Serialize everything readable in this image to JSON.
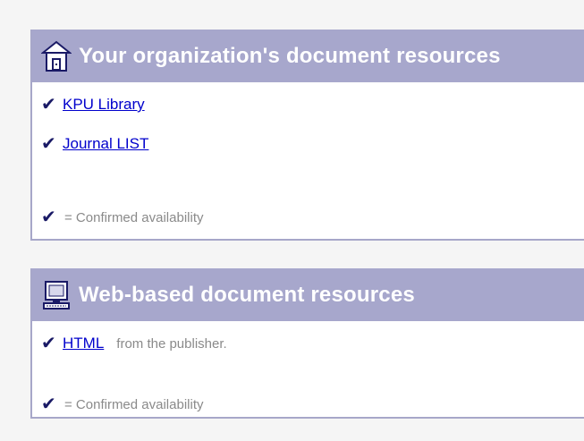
{
  "org_panel": {
    "title": "Your organization's document resources",
    "icon": "library-building-icon",
    "links": [
      {
        "check": "✔",
        "label": "KPU Library"
      },
      {
        "check": "✔",
        "label": "Journal LIST"
      }
    ],
    "legend": {
      "check": "✔",
      "text": "= Confirmed availability"
    }
  },
  "web_panel": {
    "title": "Web-based document resources",
    "icon": "computer-icon",
    "links": [
      {
        "check": "✔",
        "label": "HTML",
        "note": "from the publisher."
      }
    ],
    "legend": {
      "check": "✔",
      "text": "= Confirmed availability"
    }
  },
  "colors": {
    "header_bg": "#a7a7cc",
    "header_text": "#ffffff",
    "link": "#0000cc",
    "check": "#1a1a66",
    "muted_text": "#8a8a8a"
  }
}
